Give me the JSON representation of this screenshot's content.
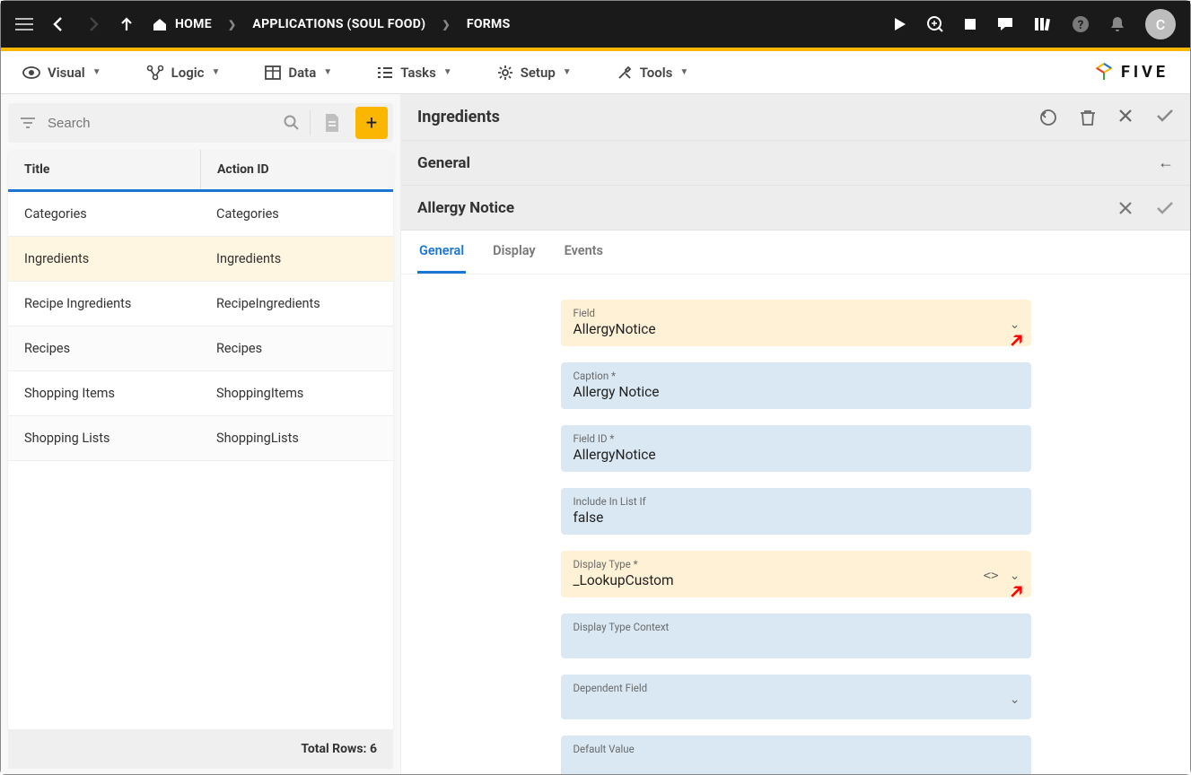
{
  "topbar": {
    "avatar_initial": "C",
    "breadcrumbs": [
      {
        "label": "HOME"
      },
      {
        "label": "APPLICATIONS (SOUL FOOD)"
      },
      {
        "label": "FORMS"
      }
    ]
  },
  "menubar": {
    "items": [
      "Visual",
      "Logic",
      "Data",
      "Tasks",
      "Setup",
      "Tools"
    ],
    "brand": "FIVE"
  },
  "search": {
    "placeholder": "Search"
  },
  "grid": {
    "columns": {
      "title": "Title",
      "action_id": "Action ID"
    },
    "rows": [
      {
        "title": "Categories",
        "action_id": "Categories"
      },
      {
        "title": "Ingredients",
        "action_id": "Ingredients"
      },
      {
        "title": "Recipe Ingredients",
        "action_id": "RecipeIngredients"
      },
      {
        "title": "Recipes",
        "action_id": "Recipes"
      },
      {
        "title": "Shopping Items",
        "action_id": "ShoppingItems"
      },
      {
        "title": "Shopping Lists",
        "action_id": "ShoppingLists"
      }
    ],
    "selected_index": 1,
    "footer_label": "Total Rows:",
    "footer_count": "6"
  },
  "detail": {
    "panel1_title": "Ingredients",
    "panel2_title": "General",
    "panel3_title": "Allergy Notice",
    "tabs": [
      "General",
      "Display",
      "Events"
    ],
    "active_tab": 0,
    "fields": [
      {
        "label": "Field",
        "value": "AllergyNotice",
        "style": "yellow",
        "dropdown": true
      },
      {
        "label": "Caption *",
        "value": "Allergy Notice",
        "style": "blue",
        "dropdown": false
      },
      {
        "label": "Field ID *",
        "value": "AllergyNotice",
        "style": "blue",
        "dropdown": false
      },
      {
        "label": "Include In List If",
        "value": "false",
        "style": "blue",
        "dropdown": false
      },
      {
        "label": "Display Type *",
        "value": "_LookupCustom",
        "style": "yellow",
        "dropdown": true,
        "code_icon": true
      },
      {
        "label": "Display Type Context",
        "value": "",
        "style": "blue",
        "dropdown": false
      },
      {
        "label": "Dependent Field",
        "value": "",
        "style": "blue",
        "dropdown": true
      },
      {
        "label": "Default Value",
        "value": "",
        "style": "blue",
        "dropdown": false
      }
    ]
  }
}
